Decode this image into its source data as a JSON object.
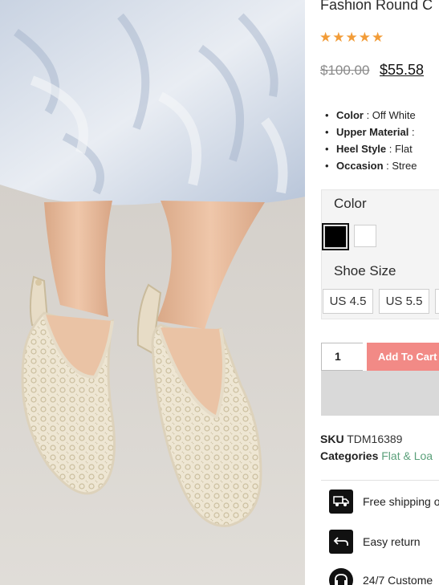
{
  "product": {
    "title": "Fashion Round C",
    "rating_stars": "★★★★★",
    "price_old": "$100.00",
    "price_new": "$55.58"
  },
  "attributes": [
    {
      "label": "Color",
      "value": ": Off White"
    },
    {
      "label": "Upper Material",
      "value": ":"
    },
    {
      "label": "Heel Style",
      "value": ": Flat"
    },
    {
      "label": "Occasion",
      "value": ": Stree"
    }
  ],
  "options": {
    "color_label": "Color",
    "colors": [
      "#000000",
      "#ffffff"
    ],
    "size_label": "Shoe Size",
    "sizes": [
      "US 4.5",
      "US 5.5"
    ]
  },
  "cart": {
    "quantity": "1",
    "add_label": "Add To Cart"
  },
  "meta": {
    "sku_label": "SKU",
    "sku_value": "TDM16389",
    "categories_label": "Categories",
    "categories_value": "Flat & Loa"
  },
  "features": [
    {
      "icon": "truck-icon",
      "text": "Free shipping o"
    },
    {
      "icon": "return-arrow-icon",
      "text": "Easy return"
    },
    {
      "icon": "headset-icon",
      "text": "24/7 Custome"
    }
  ],
  "colors": {
    "star": "#f29c38",
    "cart_button": "#f28a86",
    "link": "#5aa07a"
  }
}
